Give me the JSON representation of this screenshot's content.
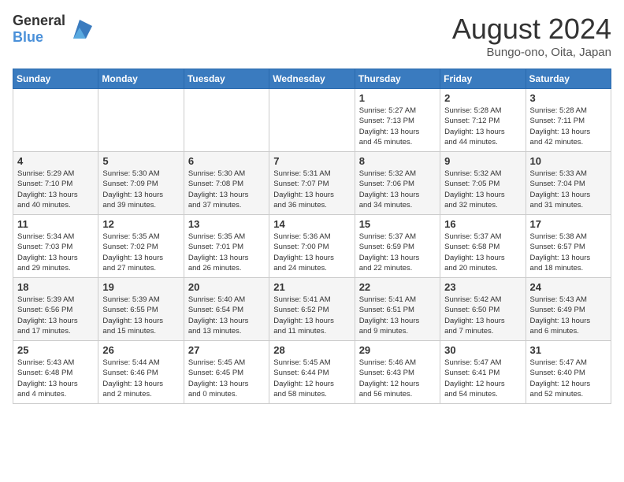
{
  "header": {
    "logo_general": "General",
    "logo_blue": "Blue",
    "month_year": "August 2024",
    "location": "Bungo-ono, Oita, Japan"
  },
  "weekdays": [
    "Sunday",
    "Monday",
    "Tuesday",
    "Wednesday",
    "Thursday",
    "Friday",
    "Saturday"
  ],
  "weeks": [
    [
      {
        "day": "",
        "info": ""
      },
      {
        "day": "",
        "info": ""
      },
      {
        "day": "",
        "info": ""
      },
      {
        "day": "",
        "info": ""
      },
      {
        "day": "1",
        "info": "Sunrise: 5:27 AM\nSunset: 7:13 PM\nDaylight: 13 hours\nand 45 minutes."
      },
      {
        "day": "2",
        "info": "Sunrise: 5:28 AM\nSunset: 7:12 PM\nDaylight: 13 hours\nand 44 minutes."
      },
      {
        "day": "3",
        "info": "Sunrise: 5:28 AM\nSunset: 7:11 PM\nDaylight: 13 hours\nand 42 minutes."
      }
    ],
    [
      {
        "day": "4",
        "info": "Sunrise: 5:29 AM\nSunset: 7:10 PM\nDaylight: 13 hours\nand 40 minutes."
      },
      {
        "day": "5",
        "info": "Sunrise: 5:30 AM\nSunset: 7:09 PM\nDaylight: 13 hours\nand 39 minutes."
      },
      {
        "day": "6",
        "info": "Sunrise: 5:30 AM\nSunset: 7:08 PM\nDaylight: 13 hours\nand 37 minutes."
      },
      {
        "day": "7",
        "info": "Sunrise: 5:31 AM\nSunset: 7:07 PM\nDaylight: 13 hours\nand 36 minutes."
      },
      {
        "day": "8",
        "info": "Sunrise: 5:32 AM\nSunset: 7:06 PM\nDaylight: 13 hours\nand 34 minutes."
      },
      {
        "day": "9",
        "info": "Sunrise: 5:32 AM\nSunset: 7:05 PM\nDaylight: 13 hours\nand 32 minutes."
      },
      {
        "day": "10",
        "info": "Sunrise: 5:33 AM\nSunset: 7:04 PM\nDaylight: 13 hours\nand 31 minutes."
      }
    ],
    [
      {
        "day": "11",
        "info": "Sunrise: 5:34 AM\nSunset: 7:03 PM\nDaylight: 13 hours\nand 29 minutes."
      },
      {
        "day": "12",
        "info": "Sunrise: 5:35 AM\nSunset: 7:02 PM\nDaylight: 13 hours\nand 27 minutes."
      },
      {
        "day": "13",
        "info": "Sunrise: 5:35 AM\nSunset: 7:01 PM\nDaylight: 13 hours\nand 26 minutes."
      },
      {
        "day": "14",
        "info": "Sunrise: 5:36 AM\nSunset: 7:00 PM\nDaylight: 13 hours\nand 24 minutes."
      },
      {
        "day": "15",
        "info": "Sunrise: 5:37 AM\nSunset: 6:59 PM\nDaylight: 13 hours\nand 22 minutes."
      },
      {
        "day": "16",
        "info": "Sunrise: 5:37 AM\nSunset: 6:58 PM\nDaylight: 13 hours\nand 20 minutes."
      },
      {
        "day": "17",
        "info": "Sunrise: 5:38 AM\nSunset: 6:57 PM\nDaylight: 13 hours\nand 18 minutes."
      }
    ],
    [
      {
        "day": "18",
        "info": "Sunrise: 5:39 AM\nSunset: 6:56 PM\nDaylight: 13 hours\nand 17 minutes."
      },
      {
        "day": "19",
        "info": "Sunrise: 5:39 AM\nSunset: 6:55 PM\nDaylight: 13 hours\nand 15 minutes."
      },
      {
        "day": "20",
        "info": "Sunrise: 5:40 AM\nSunset: 6:54 PM\nDaylight: 13 hours\nand 13 minutes."
      },
      {
        "day": "21",
        "info": "Sunrise: 5:41 AM\nSunset: 6:52 PM\nDaylight: 13 hours\nand 11 minutes."
      },
      {
        "day": "22",
        "info": "Sunrise: 5:41 AM\nSunset: 6:51 PM\nDaylight: 13 hours\nand 9 minutes."
      },
      {
        "day": "23",
        "info": "Sunrise: 5:42 AM\nSunset: 6:50 PM\nDaylight: 13 hours\nand 7 minutes."
      },
      {
        "day": "24",
        "info": "Sunrise: 5:43 AM\nSunset: 6:49 PM\nDaylight: 13 hours\nand 6 minutes."
      }
    ],
    [
      {
        "day": "25",
        "info": "Sunrise: 5:43 AM\nSunset: 6:48 PM\nDaylight: 13 hours\nand 4 minutes."
      },
      {
        "day": "26",
        "info": "Sunrise: 5:44 AM\nSunset: 6:46 PM\nDaylight: 13 hours\nand 2 minutes."
      },
      {
        "day": "27",
        "info": "Sunrise: 5:45 AM\nSunset: 6:45 PM\nDaylight: 13 hours\nand 0 minutes."
      },
      {
        "day": "28",
        "info": "Sunrise: 5:45 AM\nSunset: 6:44 PM\nDaylight: 12 hours\nand 58 minutes."
      },
      {
        "day": "29",
        "info": "Sunrise: 5:46 AM\nSunset: 6:43 PM\nDaylight: 12 hours\nand 56 minutes."
      },
      {
        "day": "30",
        "info": "Sunrise: 5:47 AM\nSunset: 6:41 PM\nDaylight: 12 hours\nand 54 minutes."
      },
      {
        "day": "31",
        "info": "Sunrise: 5:47 AM\nSunset: 6:40 PM\nDaylight: 12 hours\nand 52 minutes."
      }
    ]
  ]
}
